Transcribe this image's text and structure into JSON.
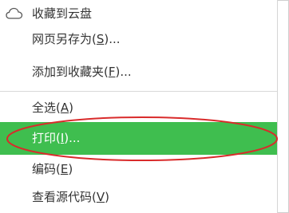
{
  "menu": {
    "items": [
      {
        "label": "收藏到云盘",
        "mnemonic": "",
        "suffix": "",
        "icon": "cloud-icon"
      },
      {
        "label": "网页另存为(",
        "mnemonic": "S",
        "suffix": ")..."
      },
      {
        "label": "添加到收藏夹(",
        "mnemonic": "F",
        "suffix": ")..."
      },
      {
        "label": "全选(",
        "mnemonic": "A",
        "suffix": ")"
      },
      {
        "label": "打印(",
        "mnemonic": "I",
        "suffix": ")..."
      },
      {
        "label": "编码(",
        "mnemonic": "E",
        "suffix": ")"
      },
      {
        "label": "查看源代码(",
        "mnemonic": "V",
        "suffix": ")"
      }
    ],
    "highlighted_item": "打印",
    "highlight_color": "#3fbe4f",
    "annotation_color": "#d92b2b"
  }
}
